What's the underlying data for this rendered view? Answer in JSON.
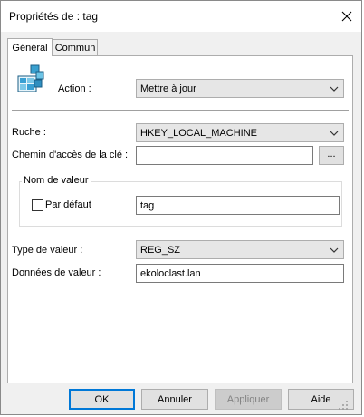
{
  "window": {
    "title": "Propriétés de : tag"
  },
  "tabs": [
    {
      "label": "Général"
    },
    {
      "label": "Commun"
    }
  ],
  "action": {
    "label": "Action :",
    "value": "Mettre à jour"
  },
  "hive": {
    "label": "Ruche :",
    "value": "HKEY_LOCAL_MACHINE"
  },
  "key_path": {
    "label": "Chemin d'accès de la clé :",
    "value": "",
    "browse_label": "..."
  },
  "value_name": {
    "group_title": "Nom de valeur",
    "default_label": "Par défaut",
    "default_checked": false,
    "value": "tag"
  },
  "value_type": {
    "label": "Type de valeur :",
    "value": "REG_SZ"
  },
  "value_data": {
    "label": "Données de valeur :",
    "value": "ekoloclast.lan"
  },
  "buttons": {
    "ok": "OK",
    "cancel": "Annuler",
    "apply": "Appliquer",
    "help": "Aide"
  },
  "colors": {
    "accent": "#0078d7",
    "window_bg": "#f0f0f0",
    "panel_bg": "#ffffff"
  }
}
